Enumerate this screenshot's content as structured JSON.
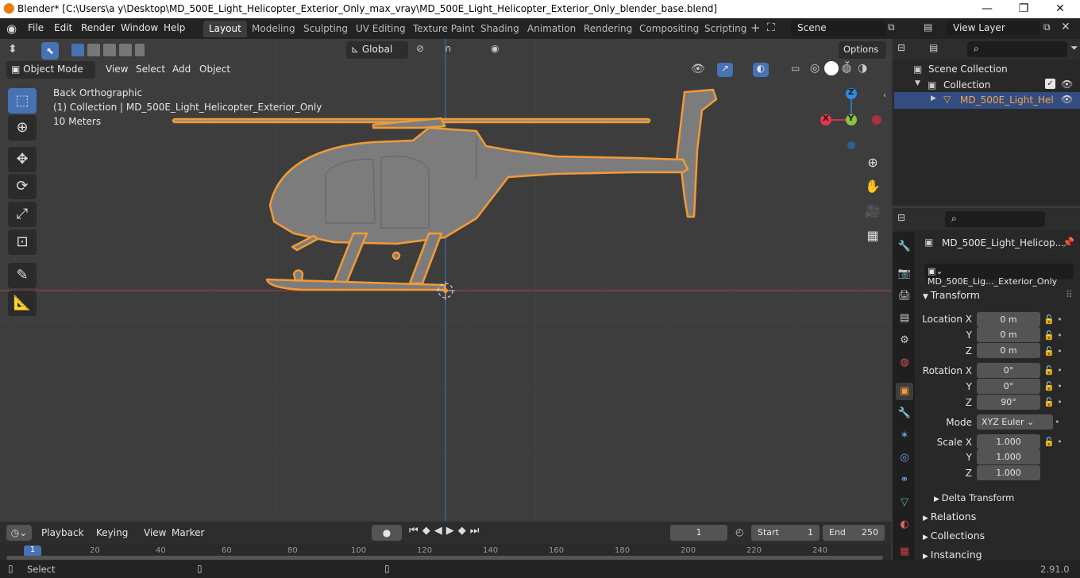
{
  "window": {
    "title": "Blender* [C:\\Users\\a y\\Desktop\\MD_500E_Light_Helicopter_Exterior_Only_max_vray\\MD_500E_Light_Helicopter_Exterior_Only_blender_base.blend]",
    "minimize": "—",
    "maximize": "❐",
    "close": "✕"
  },
  "menu": [
    "File",
    "Edit",
    "Render",
    "Window",
    "Help"
  ],
  "workspaces": [
    "Layout",
    "Modeling",
    "Sculpting",
    "UV Editing",
    "Texture Paint",
    "Shading",
    "Animation",
    "Rendering",
    "Compositing",
    "Scripting"
  ],
  "active_workspace": "Layout",
  "scene": {
    "label": "Scene",
    "view_layer": "View Layer"
  },
  "toolheader": {
    "transform_orientation": "Global",
    "options": "Options"
  },
  "viewport_header": {
    "mode": "Object Mode",
    "menus": [
      "View",
      "Select",
      "Add",
      "Object"
    ]
  },
  "overlay_text": {
    "view": "Back Orthographic",
    "collection": "(1) Collection | MD_500E_Light_Helicopter_Exterior_Only",
    "scale": "10 Meters"
  },
  "gizmo": {
    "z": "Z",
    "y": "Y",
    "x": "X"
  },
  "outliner": {
    "scene_collection": "Scene Collection",
    "collection": "Collection",
    "object": "MD_500E_Light_Hel"
  },
  "properties": {
    "object_name": "MD_500E_Light_Helicop...",
    "mesh_name": "MD_500E_Lig..._Exterior_Only",
    "transform_header": "Transform",
    "location_label": "Location X",
    "y_label": "Y",
    "z_label": "Z",
    "location": [
      "0 m",
      "0 m",
      "0 m"
    ],
    "rotation_label": "Rotation X",
    "rotation": [
      "0°",
      "0°",
      "90°"
    ],
    "mode_label": "Mode",
    "mode": "XYZ Euler",
    "scale_label": "Scale X",
    "scale": [
      "1.000",
      "1.000",
      "1.000"
    ],
    "delta": "Delta Transform",
    "relations": "Relations",
    "collections": "Collections",
    "instancing": "Instancing"
  },
  "timeline": {
    "menus": [
      "Playback",
      "Keying",
      "View",
      "Marker"
    ],
    "current_frame": "1",
    "start_label": "Start",
    "start": "1",
    "end_label": "End",
    "end": "250",
    "ruler": [
      "1",
      "20",
      "40",
      "60",
      "80",
      "100",
      "120",
      "140",
      "160",
      "180",
      "200",
      "220",
      "240"
    ]
  },
  "status": {
    "select": "Select",
    "version": "2.91.0"
  },
  "colors": {
    "accent": "#4772b3",
    "selection": "#f29b35",
    "bg": "#3d3d3d"
  }
}
